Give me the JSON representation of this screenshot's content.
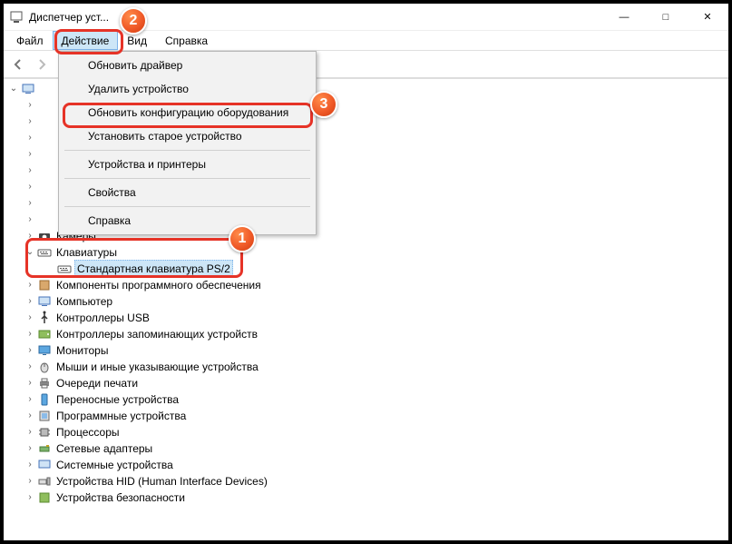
{
  "window": {
    "title": "Диспетчер уст..."
  },
  "menubar": {
    "file": "Файл",
    "action": "Действие",
    "view": "Вид",
    "help": "Справка"
  },
  "dropdown": {
    "update_driver": "Обновить драйвер",
    "remove_device": "Удалить устройство",
    "scan_hardware": "Обновить конфигурацию оборудования",
    "add_legacy": "Установить старое устройство",
    "devices_printers": "Устройства и принтеры",
    "properties": "Свойства",
    "help": "Справка"
  },
  "tree": {
    "root": "",
    "partial_row": "",
    "cameras": "Камеры",
    "keyboards": "Клавиатуры",
    "keyboards_child": "Стандартная клавиатура PS/2",
    "software_components": "Компоненты программного обеспечения",
    "computer": "Компьютер",
    "usb_controllers": "Контроллеры USB",
    "storage_controllers": "Контроллеры запоминающих устройств",
    "monitors": "Мониторы",
    "mice": "Мыши и иные указывающие устройства",
    "print_queues": "Очереди печати",
    "portable_devices": "Переносные устройства",
    "firmware": "Программные устройства",
    "processors": "Процессоры",
    "network_adapters": "Сетевые адаптеры",
    "system_devices": "Системные устройства",
    "hid": "Устройства HID (Human Interface Devices)",
    "security_devices": "Устройства безопасности"
  },
  "annotations": {
    "b1": "1",
    "b2": "2",
    "b3": "3"
  }
}
